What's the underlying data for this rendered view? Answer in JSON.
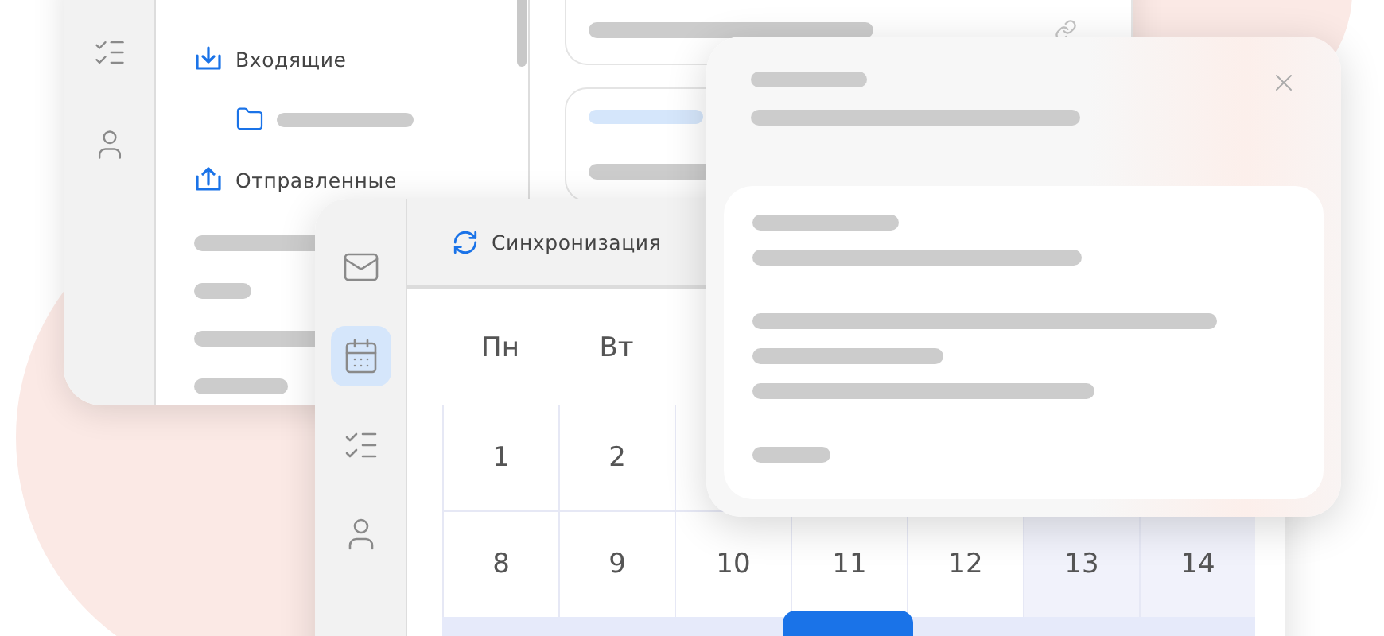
{
  "mail_window": {
    "folders": [
      {
        "kind": "incoming",
        "label": "Входящие",
        "children": [
          {
            "kind": "folder"
          }
        ]
      },
      {
        "kind": "outgoing",
        "label": "Отправленные"
      }
    ]
  },
  "calendar_window": {
    "rail": [
      {
        "kind": "mail",
        "selected": false
      },
      {
        "kind": "calendar",
        "selected": true
      },
      {
        "kind": "tasks",
        "selected": false
      },
      {
        "kind": "contacts",
        "selected": false
      }
    ],
    "toolbar": {
      "sync_label": "Синхронизация"
    },
    "weekdays": [
      "Пн",
      "Вт"
    ],
    "weeks": [
      [
        {
          "day": "1",
          "highlighted": false
        },
        {
          "day": "2",
          "highlighted": false
        }
      ],
      [
        {
          "day": "8",
          "highlighted": false
        },
        {
          "day": "9",
          "highlighted": false
        },
        {
          "day": "10",
          "highlighted": false
        },
        {
          "day": "11",
          "highlighted": false
        },
        {
          "day": "12",
          "highlighted": false
        },
        {
          "day": "13",
          "highlighted": true
        },
        {
          "day": "14",
          "highlighted": true
        }
      ]
    ]
  }
}
